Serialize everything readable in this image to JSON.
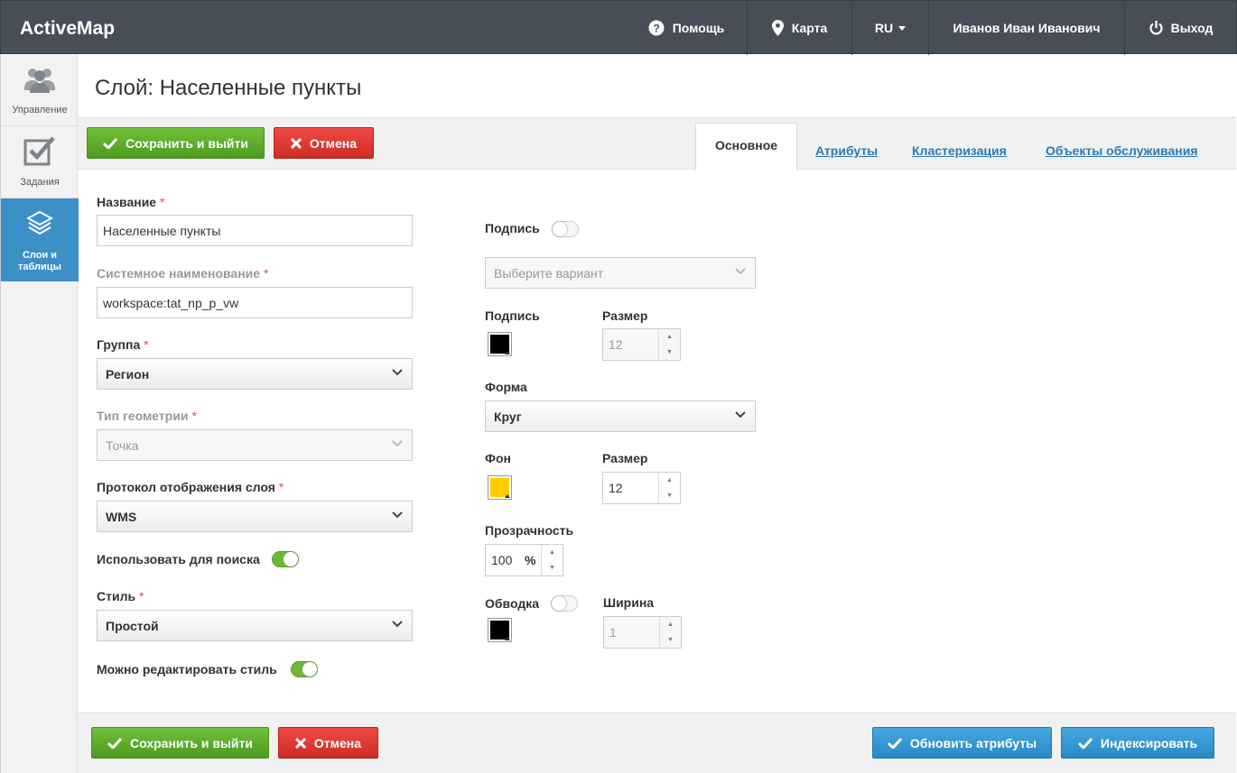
{
  "app": {
    "title": "ActiveMap"
  },
  "nav": {
    "help": "Помощь",
    "map": "Карта",
    "lang": "RU",
    "user": "Иванов Иван Иванович",
    "logout": "Выход"
  },
  "sidebar": {
    "items": [
      {
        "label": "Управление",
        "icon": "users-icon"
      },
      {
        "label": "Задания",
        "icon": "checkbox-icon"
      },
      {
        "label_line1": "Слои и",
        "label_line2": "таблицы",
        "icon": "layers-icon"
      }
    ]
  },
  "page": {
    "title": "Слой: Населенные пункты"
  },
  "toolbar": {
    "save_label": "Сохранить и выйти",
    "cancel_label": "Отмена"
  },
  "tabs": [
    "Основное",
    "Атрибуты",
    "Кластеризация",
    "Объекты обслуживания"
  ],
  "form": {
    "name_label": "Название",
    "name_value": "Населенные пункты",
    "sysname_label": "Системное наименование",
    "sysname_value": "workspace:tat_np_p_vw",
    "group_label": "Группа",
    "group_value": "Регион",
    "geom_label": "Тип геометрии",
    "geom_value": "Точка",
    "protocol_label": "Протокол отображения слоя",
    "protocol_value": "WMS",
    "search_label": "Использовать для поиска",
    "style_label": "Стиль",
    "style_value": "Простой",
    "edit_style_label": "Можно редактировать стиль",
    "req_mark": "*"
  },
  "style": {
    "caption_toggle_label": "Подпись",
    "caption_select_placeholder": "Выберите вариант",
    "caption_color_label": "Подпись",
    "caption_size_label": "Размер",
    "caption_size_value": "12",
    "shape_label": "Форма",
    "shape_value": "Круг",
    "bg_label": "Фон",
    "bg_size_label": "Размер",
    "bg_size_value": "12",
    "opacity_label": "Прозрачность",
    "opacity_value": "100",
    "opacity_unit": "%",
    "stroke_label": "Обводка",
    "stroke_width_label": "Ширина",
    "stroke_width_value": "1",
    "colors": {
      "caption": "#000000",
      "background": "#ffcc00",
      "stroke": "#000000"
    }
  },
  "footer": {
    "save_label": "Сохранить и выйти",
    "cancel_label": "Отмена",
    "update_attrs_label": "Обновить атрибуты",
    "index_label": "Индексировать"
  }
}
